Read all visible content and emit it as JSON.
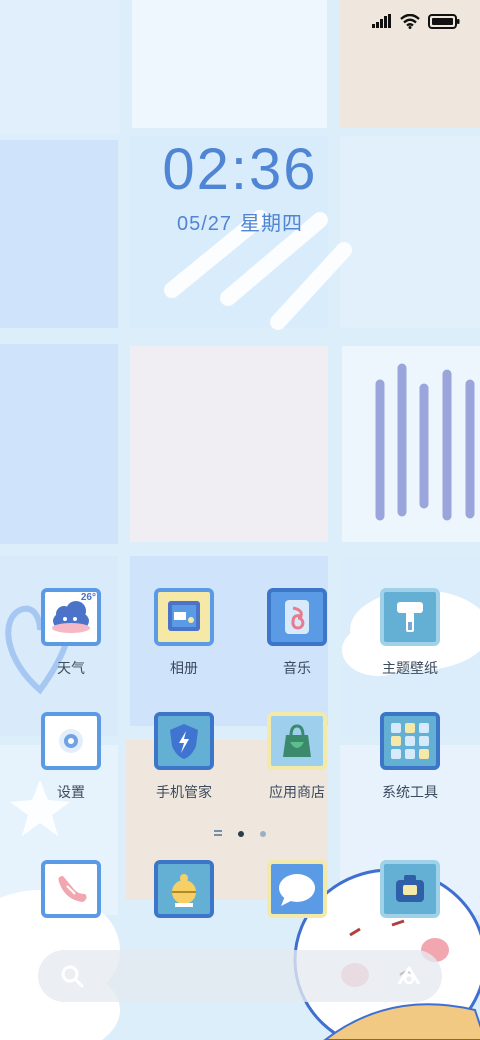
{
  "status_bar": {
    "signal_icon": "signal-icon",
    "wifi_icon": "wifi-icon",
    "battery_icon": "battery-icon"
  },
  "clock": {
    "time": "02:36",
    "date": "05/27",
    "weekday": "星期四"
  },
  "apps": [
    {
      "label": "天气",
      "icon": "weather-icon",
      "badge": "26°"
    },
    {
      "label": "相册",
      "icon": "gallery-icon"
    },
    {
      "label": "音乐",
      "icon": "music-icon"
    },
    {
      "label": "主题壁纸",
      "icon": "themes-icon"
    },
    {
      "label": "设置",
      "icon": "settings-icon"
    },
    {
      "label": "手机管家",
      "icon": "security-icon"
    },
    {
      "label": "应用商店",
      "icon": "app-store-icon"
    },
    {
      "label": "系统工具",
      "icon": "tools-folder-icon"
    }
  ],
  "dock": [
    {
      "icon": "phone-icon"
    },
    {
      "icon": "contacts-icon"
    },
    {
      "icon": "messages-icon"
    },
    {
      "icon": "camera-icon"
    }
  ],
  "page_indicator": {
    "pages": 2,
    "current": 1
  },
  "colors": {
    "accent": "#4f85d4",
    "tile_light": "#e9f4fc",
    "tile_blue": "#cfe4fb",
    "tile_beige": "#efe7dd",
    "tile_pink": "#f1eef3",
    "stripe": "#8c99d6"
  }
}
